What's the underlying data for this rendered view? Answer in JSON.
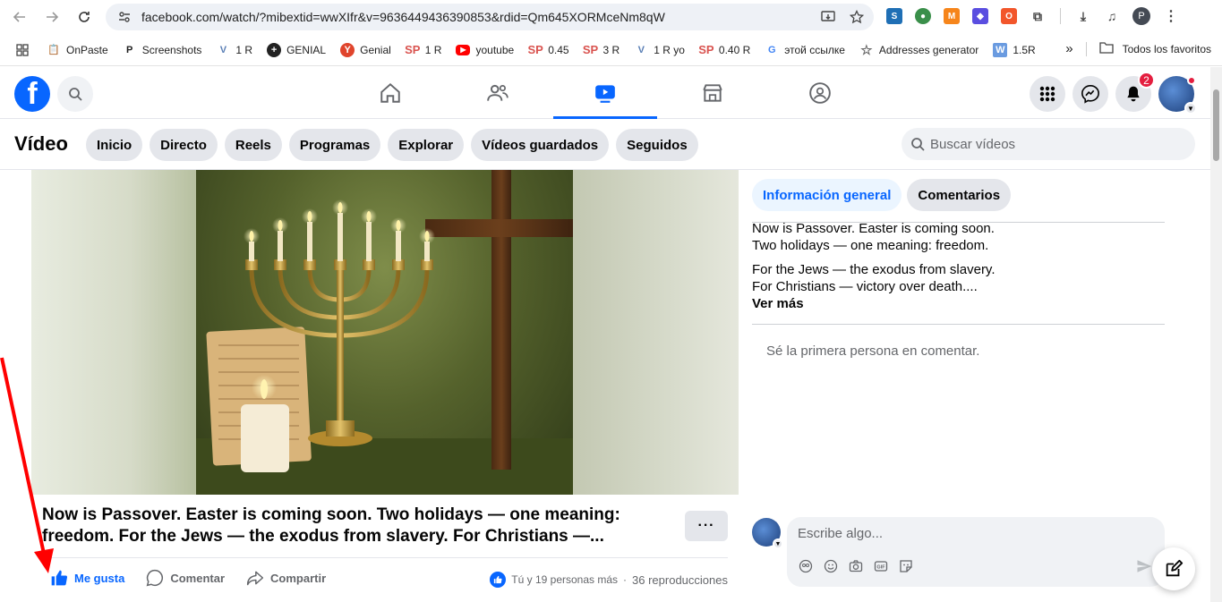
{
  "browser": {
    "url": "facebook.com/watch/?mibextid=wwXIfr&v=9636449436390853&rdid=Qm645XORMceNm8qW",
    "profile_initial": "P",
    "bookmarks": [
      {
        "label": "OnPaste",
        "icon": "onpaste-icon"
      },
      {
        "label": "Screenshots",
        "icon": "screenshots-icon",
        "glyph": "P"
      },
      {
        "label": "1 R",
        "icon": "v-icon",
        "glyph": "V"
      },
      {
        "label": "GENIAL",
        "icon": "genial-plus-icon",
        "glyph": "+"
      },
      {
        "label": "Genial",
        "icon": "genial-y-icon",
        "glyph": "Y"
      },
      {
        "label": "1 R",
        "icon": "sp-icon",
        "glyph": "SP"
      },
      {
        "label": "youtube",
        "icon": "youtube-icon"
      },
      {
        "label": "0.45",
        "icon": "sp-icon",
        "glyph": "SP"
      },
      {
        "label": "3 R",
        "icon": "sp-icon",
        "glyph": "SP"
      },
      {
        "label": "1 R yo",
        "icon": "v-icon",
        "glyph": "V"
      },
      {
        "label": "0.40 R",
        "icon": "sp-icon",
        "glyph": "SP"
      },
      {
        "label": "этой ссылке",
        "icon": "google-icon",
        "glyph": "G"
      },
      {
        "label": "Addresses generator",
        "icon": "star-outline-icon",
        "glyph": "☆"
      },
      {
        "label": "1.5R",
        "icon": "w-icon",
        "glyph": "W"
      }
    ],
    "all_bookmarks": "Todos los favoritos"
  },
  "header": {
    "logo": "f",
    "notifications_count": "2"
  },
  "video_nav": {
    "title": "Vídeo",
    "pills": [
      "Inicio",
      "Directo",
      "Reels",
      "Programas",
      "Explorar",
      "Vídeos guardados",
      "Seguidos"
    ],
    "search_placeholder": "Buscar vídeos"
  },
  "post": {
    "title": "Now is Passover. Easter is coming soon. Two holidays — one meaning: freedom. For the Jews — the exodus from slavery. For Christians —...",
    "more": "···",
    "actions": {
      "like": "Me gusta",
      "comment": "Comentar",
      "share": "Compartir"
    },
    "reactions_text": "Tú y 19 personas más",
    "separator": "·",
    "views_text": "36 reproducciones"
  },
  "panel": {
    "tab_overview": "Información general",
    "tab_comments": "Comentarios",
    "desc_line1": "Now is Passover. Easter is coming soon.",
    "desc_line2": "Two holidays — one meaning: freedom.",
    "desc_line3": "For the Jews — the exodus from slavery.",
    "desc_line4": "For Christians — victory over death....",
    "see_more": "Ver más",
    "first_comment": "Sé la primera persona en comentar.",
    "comment_placeholder": "Escribe algo..."
  },
  "colors": {
    "facebook_blue": "#0866ff",
    "annotation_arrow": "#ff0000"
  }
}
